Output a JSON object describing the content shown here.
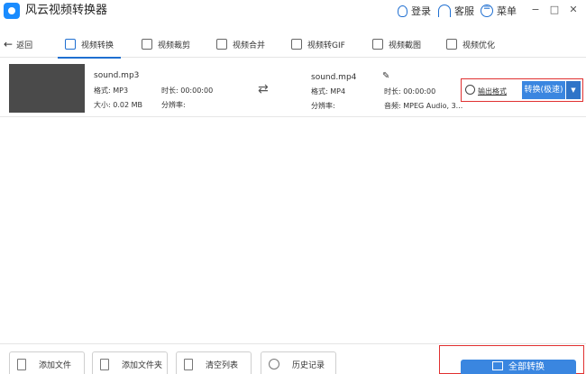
{
  "app": {
    "title": "风云视频转换器"
  },
  "titlebar": {
    "login": "登录",
    "service": "客服",
    "menu": "菜单",
    "minimize": "−",
    "maximize": "□",
    "close": "✕"
  },
  "toolbar": {
    "back": "返回",
    "tabs": [
      {
        "label": "视频转换",
        "icon": "video-convert-icon"
      },
      {
        "label": "视频裁剪",
        "icon": "video-crop-icon"
      },
      {
        "label": "视频合并",
        "icon": "video-merge-icon"
      },
      {
        "label": "视频转GIF",
        "icon": "gif-icon"
      },
      {
        "label": "视频截图",
        "icon": "screenshot-icon"
      },
      {
        "label": "视频优化",
        "icon": "optimize-icon"
      }
    ]
  },
  "file": {
    "source": {
      "name": "sound.mp3",
      "format": "格式: MP3",
      "duration": "时长: 00:00:00",
      "size": "大小: 0.02 MB",
      "resolution": "分辨率:"
    },
    "target": {
      "name": "sound.mp4",
      "format": "格式: MP4",
      "duration": "时长: 00:00:00",
      "resolution": "分辨率:",
      "audio": "音频: MPEG Audio, 3..."
    },
    "output_format": "输出格式",
    "convert": "转换(极速)",
    "dropdown": "▼"
  },
  "bottom": {
    "add_file": "添加文件",
    "add_folder": "添加文件夹",
    "clear_list": "清空列表",
    "history": "历史记录",
    "convert_all": "全部转换"
  }
}
